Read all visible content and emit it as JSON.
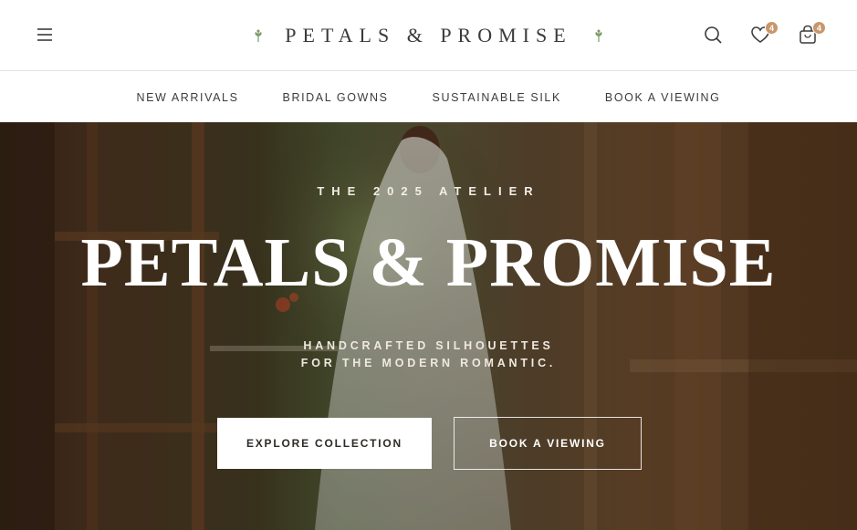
{
  "header": {
    "brand": "PETALS & PROMISE",
    "icons": {
      "menu": "hamburger-menu-icon",
      "search": "search-icon",
      "wishlist": "heart-icon",
      "cart": "shopping-bag-icon",
      "sprig": "leaf-sprig-icon"
    },
    "wishlist_count": "4",
    "cart_count": "4",
    "badge_color": "#c9976a"
  },
  "nav": {
    "items": [
      {
        "label": "NEW ARRIVALS"
      },
      {
        "label": "BRIDAL GOWNS"
      },
      {
        "label": "SUSTAINABLE SILK"
      },
      {
        "label": "BOOK A VIEWING"
      }
    ]
  },
  "hero": {
    "eyebrow": "THE 2025 ATELIER",
    "title": "PETALS & PROMISE",
    "subtitle_line1": "HANDCRAFTED SILHOUETTES",
    "subtitle_line2": "FOR THE MODERN ROMANTIC.",
    "primary_cta": "EXPLORE COLLECTION",
    "secondary_cta": "BOOK A VIEWING"
  },
  "colors": {
    "accent": "#c9976a",
    "sprig_green": "#7a9a6a",
    "text_dark": "#2e2a26"
  }
}
